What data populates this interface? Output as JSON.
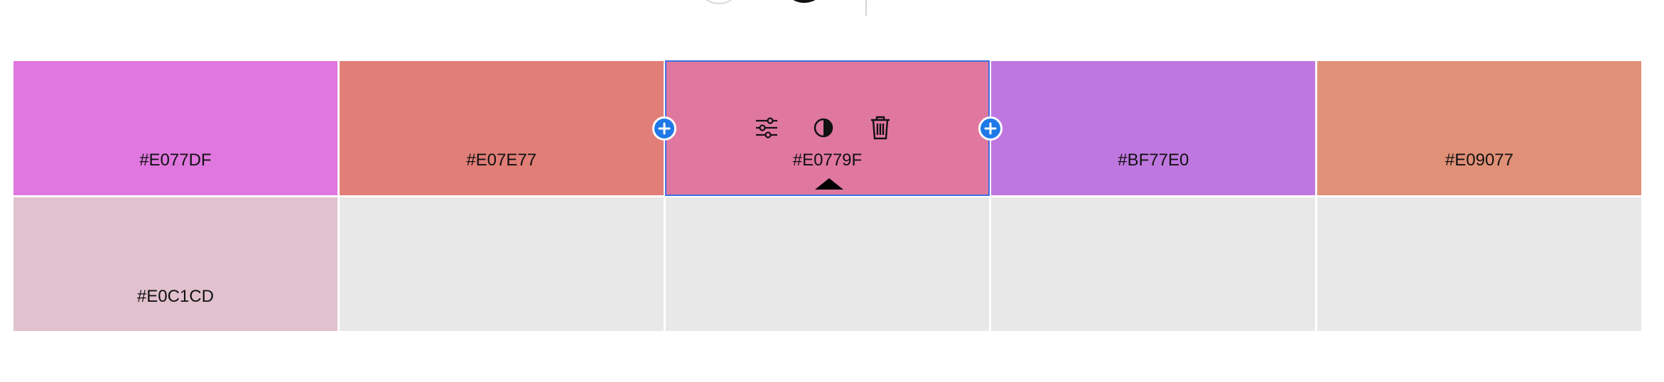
{
  "toolbar": {
    "icons": [
      "circle-outline-icon",
      "circle-solid-icon"
    ]
  },
  "palette": {
    "swatches": [
      {
        "hex": "#E077DF",
        "color": "#E077DF"
      },
      {
        "hex": "#E07E77",
        "color": "#E07E77"
      },
      {
        "hex": "#E0779F",
        "color": "#E0779F",
        "selected": true
      },
      {
        "hex": "#BF77E0",
        "color": "#BF77E0"
      },
      {
        "hex": "#E09077",
        "color": "#E09077"
      },
      {
        "hex": "#E0C1CD",
        "color": "#E0C1CD"
      },
      {
        "hex": "",
        "color": "#E8E8E8"
      },
      {
        "hex": "",
        "color": "#E8E8E8"
      },
      {
        "hex": "",
        "color": "#E8E8E8"
      },
      {
        "hex": "",
        "color": "#E8E8E8"
      }
    ],
    "selected_tools": [
      "adjust-sliders-icon",
      "contrast-icon",
      "trash-icon"
    ],
    "accent_color": "#1F78E6",
    "selection_border_color": "#3D6FE0"
  }
}
